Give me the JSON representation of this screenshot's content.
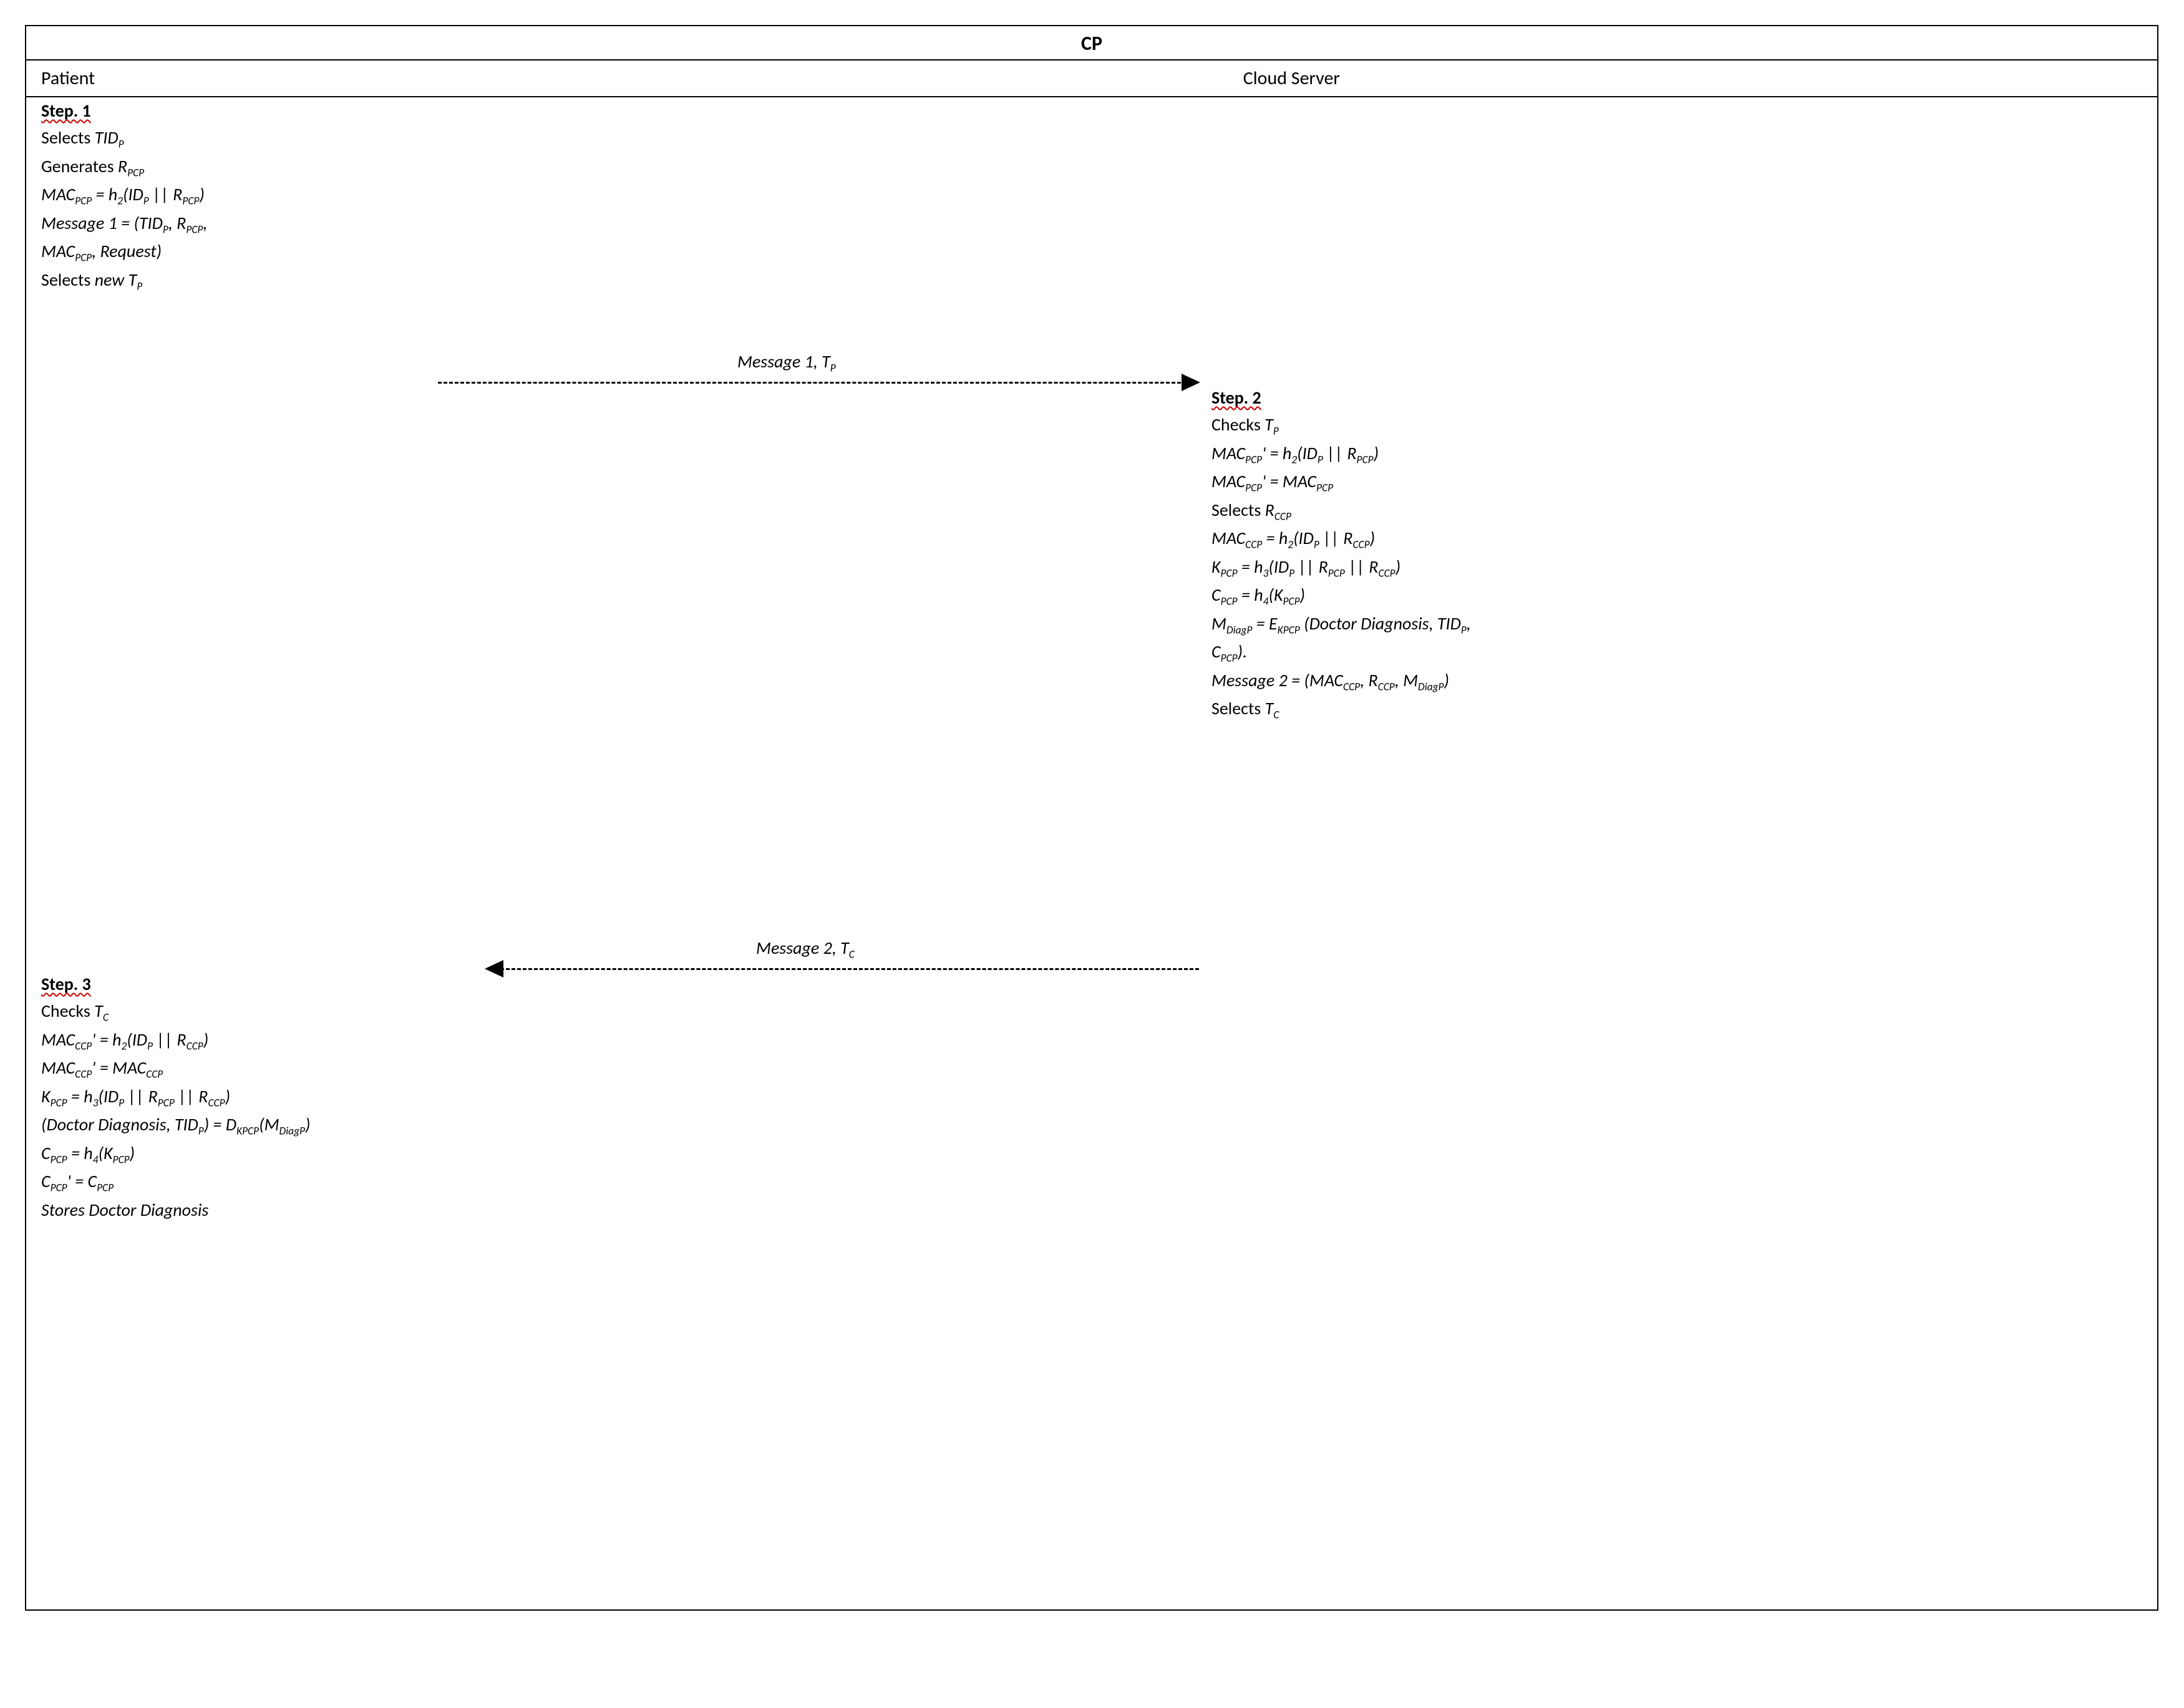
{
  "title": "CP",
  "header": {
    "left": "Patient",
    "right": "Cloud Server"
  },
  "step1": {
    "title": "Step. 1",
    "l1a": "Selects ",
    "l1b": "TID",
    "l1s": "P",
    "l2a": "Generates ",
    "l2b": "R",
    "l2s": "PCP",
    "l3a": "MAC",
    "l3s": "PCP",
    "l3b": " = h",
    "l3s2": "2",
    "l3c": "(ID",
    "l3s3": "P",
    "l3d": " || R",
    "l3s4": "PCP",
    "l3e": ")",
    "l4a": "Message 1",
    "l4b": " = (TID",
    "l4s1": "P",
    "l4c": ", R",
    "l4s2": "PCP",
    "l4d": ",",
    "l5a": " MAC",
    "l5s": "PCP",
    "l5b": ", Request)",
    "l6a": "Selects ",
    "l6b": "new T",
    "l6s": "P"
  },
  "arrow1": {
    "label_a": "Message 1, T",
    "label_s": "P"
  },
  "step2": {
    "title": "Step. 2",
    "l1a": "Checks ",
    "l1b": "T",
    "l1s": "P",
    "l2a": "MAC",
    "l2s1": "PCP",
    "l2b": "' = h",
    "l2s2": "2",
    "l2c": "(ID",
    "l2s3": "P",
    "l2d": " || R",
    "l2s4": "PCP",
    "l2e": ")",
    "l3a": "MAC",
    "l3s1": "PCP",
    "l3b": "' = MAC",
    "l3s2": "PCP",
    "l4a": "Selects ",
    "l4b": "R",
    "l4s": "CCP",
    "l5a": "MAC",
    "l5s1": "CCP",
    "l5b": " = h",
    "l5s2": "2",
    "l5c": "(ID",
    "l5s3": "P",
    "l5d": " || R",
    "l5s4": "CCP",
    "l5e": ")",
    "l6a": "K",
    "l6s1": "PCP",
    "l6b": " = h",
    "l6s2": "3",
    "l6c": "(ID",
    "l6s3": "P",
    "l6d": " || R",
    "l6s4": "PCP",
    "l6e": " || R",
    "l6s5": "CCP",
    "l6f": ")",
    "l7a": "C",
    "l7s1": "PCP",
    "l7b": " = h",
    "l7s2": "4",
    "l7c": "(K",
    "l7s3": "PCP",
    "l7d": ")",
    "l8a": "M",
    "l8s1": "DiagP",
    "l8b": " = E",
    "l8s2": "KPCP",
    "l8c": " (Doctor Diagnosis, TID",
    "l8s3": "P",
    "l8d": ",",
    "l9a": "C",
    "l9s": "PCP",
    "l9b": ").",
    "l10a": "Message 2",
    "l10b": " = (MAC",
    "l10s1": "CCP",
    "l10c": ", R",
    "l10s2": "CCP",
    "l10d": ", M",
    "l10s3": "DiagP",
    "l10e": ")",
    "l11a": "Selects ",
    "l11b": "T",
    "l11s": "C"
  },
  "arrow2": {
    "label_a": "Message 2, T",
    "label_s": "C"
  },
  "step3": {
    "title": "Step. 3",
    "l1a": "Checks ",
    "l1b": "T",
    "l1s": "C",
    "l2a": "MAC",
    "l2s1": "CCP",
    "l2b": "' = h",
    "l2s2": "2",
    "l2c": "(ID",
    "l2s3": "P",
    "l2d": " || R",
    "l2s4": "CCP",
    "l2e": ")",
    "l3a": "MAC",
    "l3s1": "CCP",
    "l3b": "' = MAC",
    "l3s2": "CCP",
    "l4a": "K",
    "l4s1": "PCP",
    "l4b": " = h",
    "l4s2": "3",
    "l4c": "(ID",
    "l4s3": "P",
    "l4d": " || R",
    "l4s4": "PCP",
    "l4e": " || R",
    "l4s5": "CCP",
    "l4f": ")",
    "l5a": "(Doctor Diagnosis, TID",
    "l5s1": "P",
    "l5b": ") = D",
    "l5s2": "KPCP",
    "l5c": "(M",
    "l5s3": "DiagP",
    "l5d": ")",
    "l6a": "C",
    "l6s1": "PCP",
    "l6b": " = h",
    "l6s2": "4",
    "l6c": "(K",
    "l6s3": "PCP",
    "l6d": ")",
    "l7a": "C",
    "l7s1": "PCP",
    "l7b": "' = C",
    "l7s2": "PCP",
    "l8": "Stores Doctor Diagnosis"
  }
}
